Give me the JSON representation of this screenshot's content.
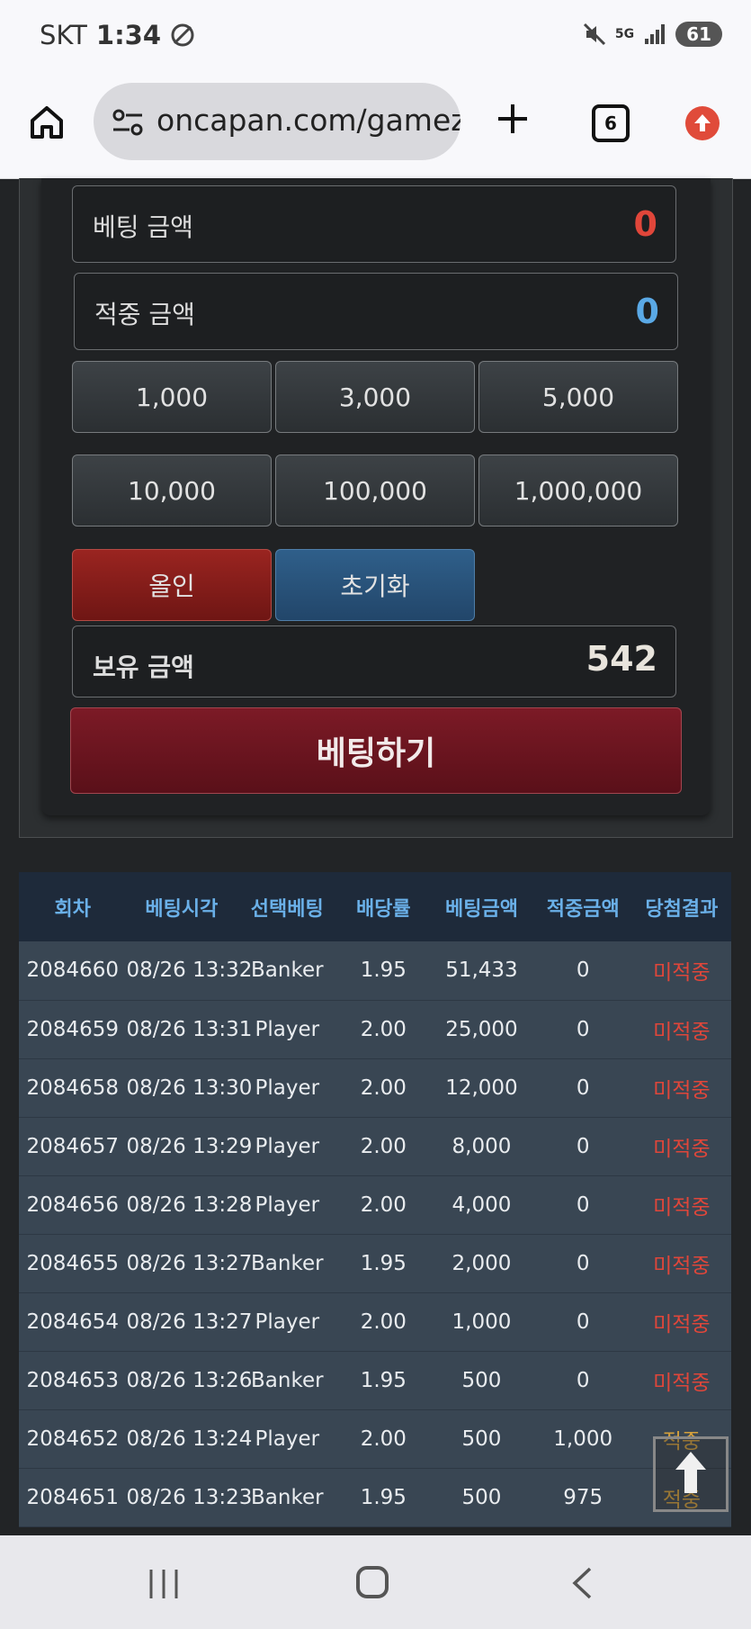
{
  "status_bar": {
    "carrier": "SKT",
    "time": "1:34",
    "network": "5G",
    "battery": "61"
  },
  "browser": {
    "url": "oncapan.com/gamez",
    "tab_count": "6"
  },
  "betting": {
    "bet_amount_label": "베팅 금액",
    "bet_amount_value": "0",
    "win_amount_label": "적중 금액",
    "win_amount_value": "0",
    "chips": [
      "1,000",
      "3,000",
      "5,000",
      "10,000",
      "100,000",
      "1,000,000"
    ],
    "all_in_label": "올인",
    "reset_label": "초기화",
    "balance_label": "보유 금액",
    "balance_value": "542",
    "submit_label": "베팅하기",
    "colors": {
      "bet_value": "#e0463a",
      "win_value": "#5aa9e6"
    }
  },
  "history": {
    "headers": [
      "회차",
      "베팅시각",
      "선택베팅",
      "배당률",
      "베팅금액",
      "적중금액",
      "당첨결과"
    ],
    "rows": [
      [
        "2084660",
        "08/26 13:32",
        "Banker",
        "1.95",
        "51,433",
        "0",
        "미적중"
      ],
      [
        "2084659",
        "08/26 13:31",
        "Player",
        "2.00",
        "25,000",
        "0",
        "미적중"
      ],
      [
        "2084658",
        "08/26 13:30",
        "Player",
        "2.00",
        "12,000",
        "0",
        "미적중"
      ],
      [
        "2084657",
        "08/26 13:29",
        "Player",
        "2.00",
        "8,000",
        "0",
        "미적중"
      ],
      [
        "2084656",
        "08/26 13:28",
        "Player",
        "2.00",
        "4,000",
        "0",
        "미적중"
      ],
      [
        "2084655",
        "08/26 13:27",
        "Banker",
        "1.95",
        "2,000",
        "0",
        "미적중"
      ],
      [
        "2084654",
        "08/26 13:27",
        "Player",
        "2.00",
        "1,000",
        "0",
        "미적중"
      ],
      [
        "2084653",
        "08/26 13:26",
        "Banker",
        "1.95",
        "500",
        "0",
        "미적중"
      ],
      [
        "2084652",
        "08/26 13:24",
        "Player",
        "2.00",
        "500",
        "1,000",
        "적중"
      ],
      [
        "2084651",
        "08/26 13:23",
        "Banker",
        "1.95",
        "500",
        "975",
        "적중"
      ]
    ]
  }
}
